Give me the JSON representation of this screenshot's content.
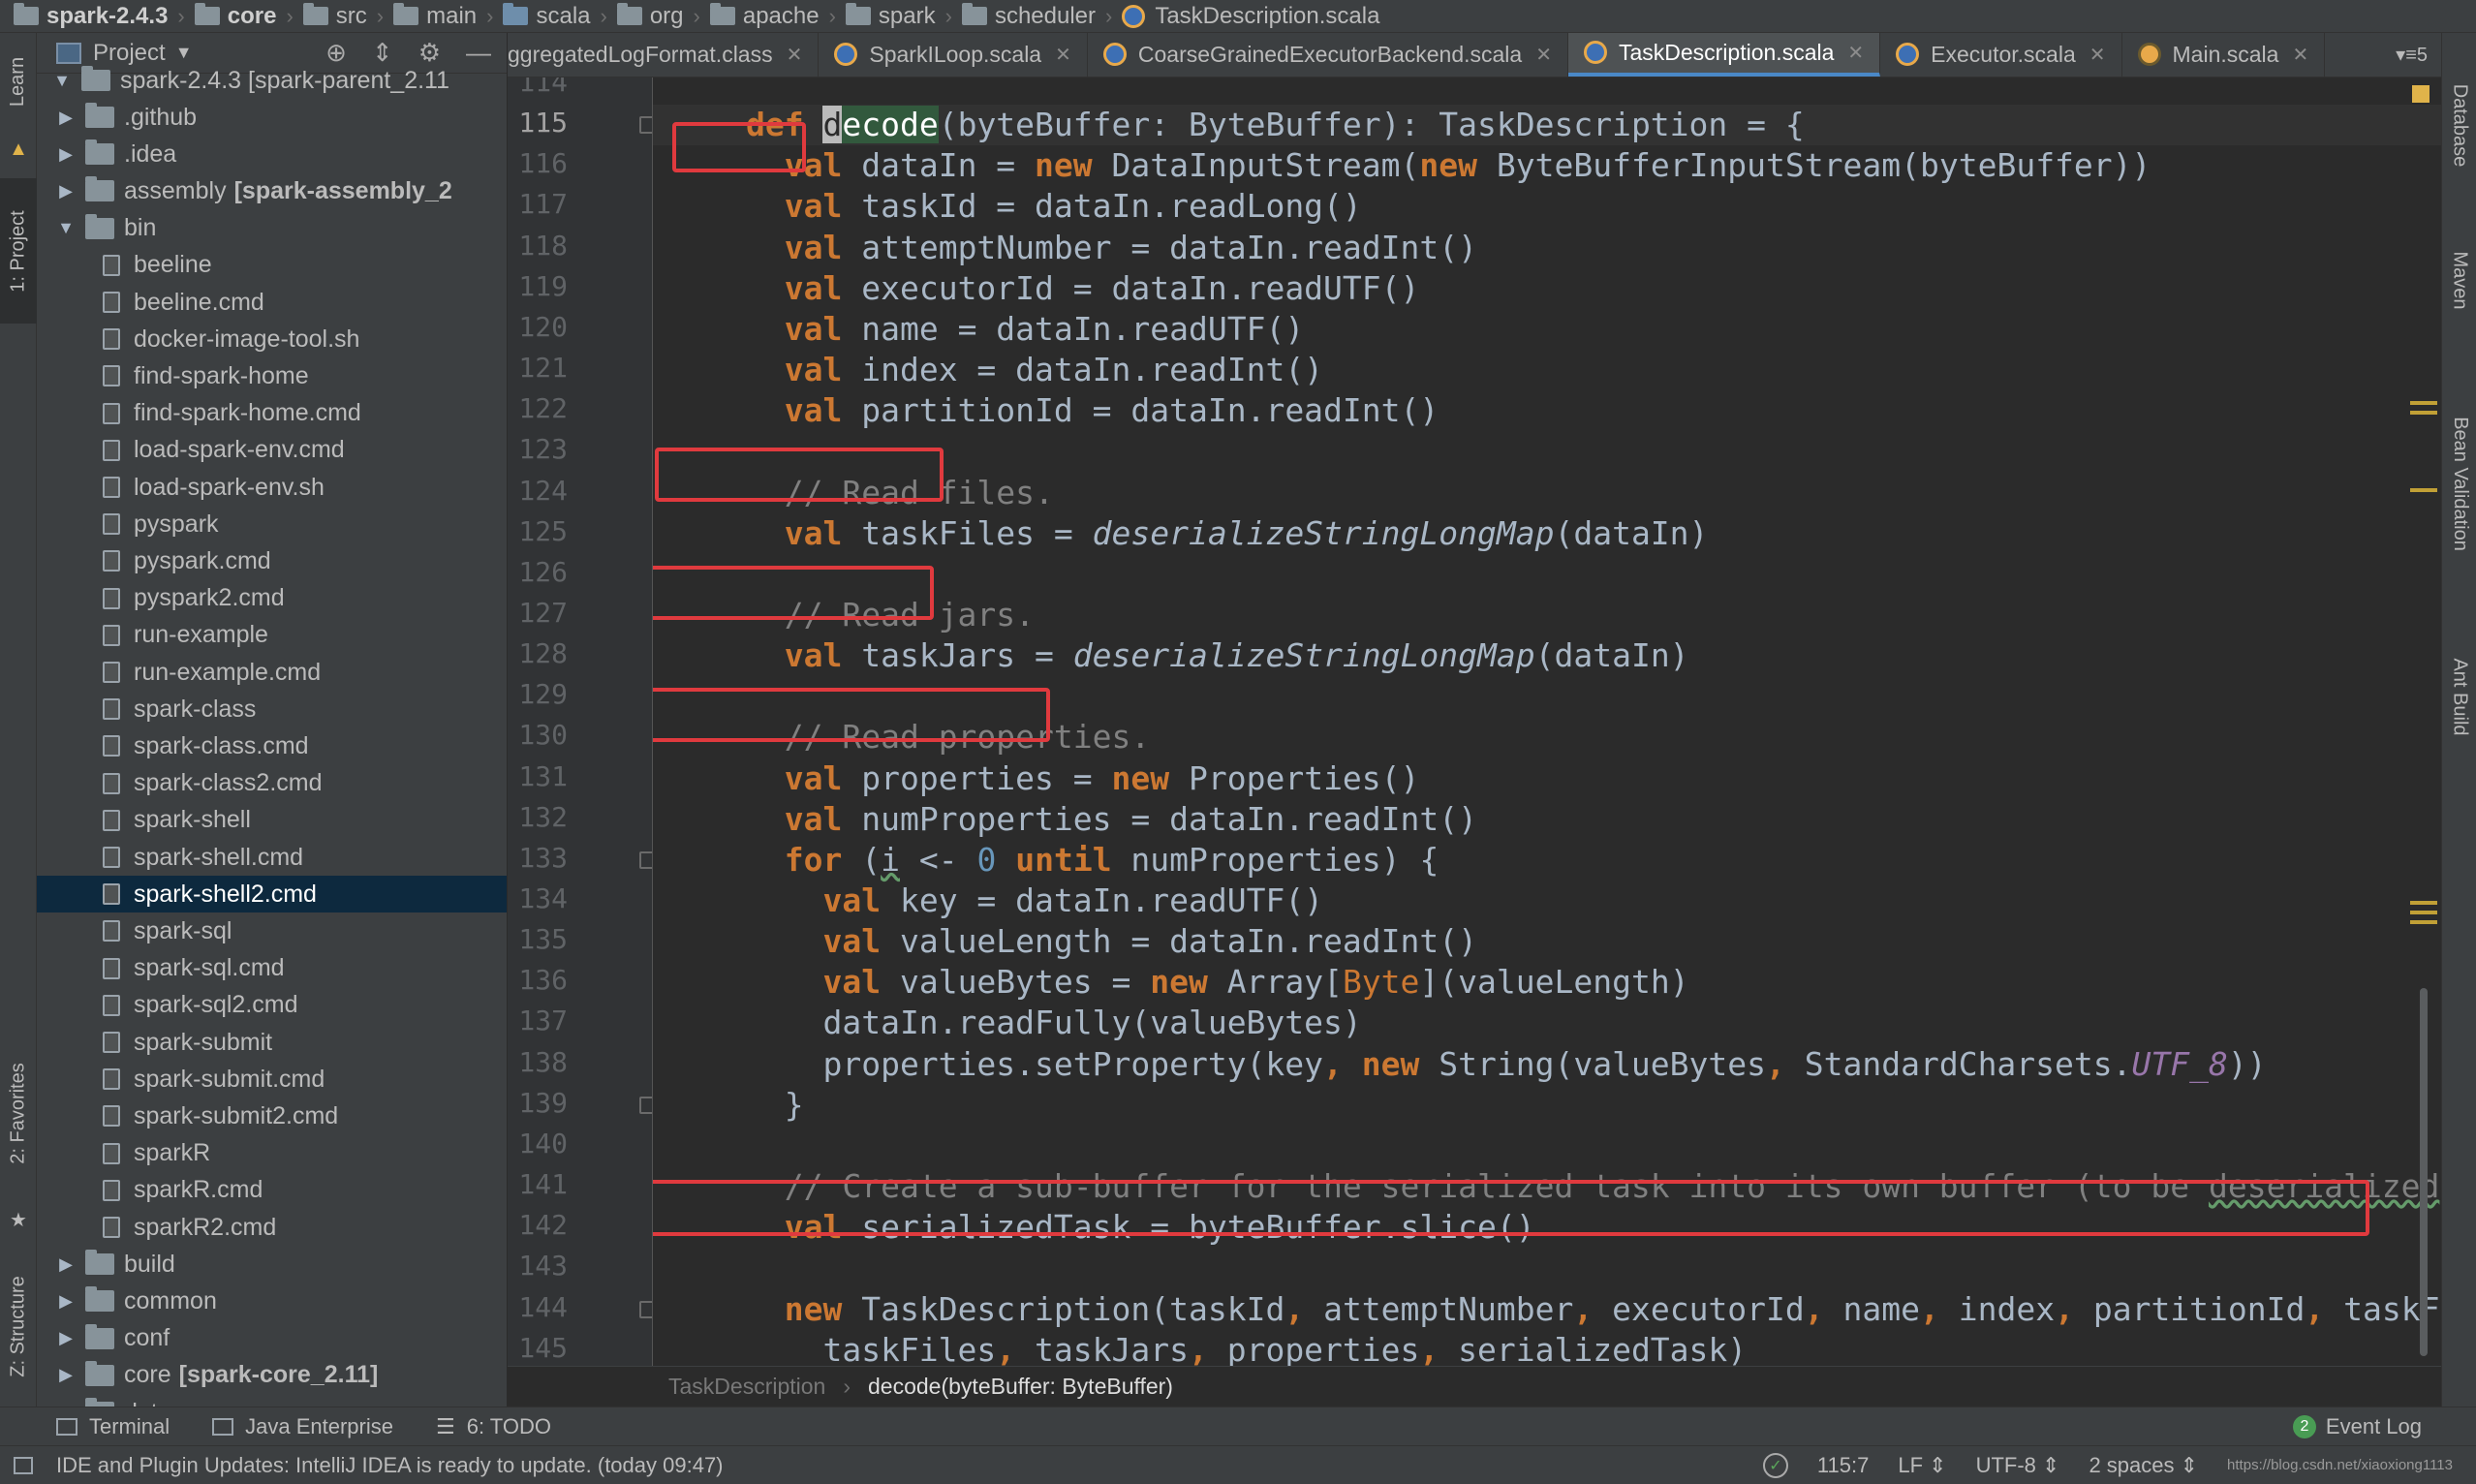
{
  "breadcrumb": [
    {
      "label": "spark-2.4.3",
      "bold": true
    },
    {
      "label": "core",
      "bold": true
    },
    {
      "label": "src"
    },
    {
      "label": "main"
    },
    {
      "label": "scala"
    },
    {
      "label": "org"
    },
    {
      "label": "apache"
    },
    {
      "label": "spark"
    },
    {
      "label": "scheduler"
    },
    {
      "label": "TaskDescription.scala",
      "file": true
    }
  ],
  "left_strip": {
    "learn": "Learn",
    "project": "1: Project",
    "favorites": "2: Favorites",
    "structure": "Z: Structure"
  },
  "right_strip": {
    "database": "Database",
    "maven": "Maven",
    "bean": "Bean Validation",
    "ant": "Ant Build"
  },
  "project_panel": {
    "title": "Project",
    "root_label": "spark-2.4.3 [spark-parent_2.11",
    "items": [
      {
        "label": ".github",
        "type": "folder",
        "depth": 1,
        "expanded": false
      },
      {
        "label": ".idea",
        "type": "folder",
        "depth": 1,
        "expanded": false
      },
      {
        "label": "assembly",
        "module": "[spark-assembly_2",
        "type": "folder",
        "depth": 1,
        "expanded": false
      },
      {
        "label": "bin",
        "type": "folder",
        "depth": 1,
        "expanded": true
      },
      {
        "label": "beeline",
        "type": "file",
        "depth": 2
      },
      {
        "label": "beeline.cmd",
        "type": "file",
        "depth": 2
      },
      {
        "label": "docker-image-tool.sh",
        "type": "file",
        "depth": 2
      },
      {
        "label": "find-spark-home",
        "type": "file",
        "depth": 2
      },
      {
        "label": "find-spark-home.cmd",
        "type": "file",
        "depth": 2
      },
      {
        "label": "load-spark-env.cmd",
        "type": "file",
        "depth": 2
      },
      {
        "label": "load-spark-env.sh",
        "type": "file",
        "depth": 2
      },
      {
        "label": "pyspark",
        "type": "file",
        "depth": 2
      },
      {
        "label": "pyspark.cmd",
        "type": "file",
        "depth": 2
      },
      {
        "label": "pyspark2.cmd",
        "type": "file",
        "depth": 2
      },
      {
        "label": "run-example",
        "type": "file",
        "depth": 2
      },
      {
        "label": "run-example.cmd",
        "type": "file",
        "depth": 2
      },
      {
        "label": "spark-class",
        "type": "file",
        "depth": 2
      },
      {
        "label": "spark-class.cmd",
        "type": "file",
        "depth": 2
      },
      {
        "label": "spark-class2.cmd",
        "type": "file",
        "depth": 2
      },
      {
        "label": "spark-shell",
        "type": "file",
        "depth": 2
      },
      {
        "label": "spark-shell.cmd",
        "type": "file",
        "depth": 2
      },
      {
        "label": "spark-shell2.cmd",
        "type": "file",
        "depth": 2,
        "selected": true
      },
      {
        "label": "spark-sql",
        "type": "file",
        "depth": 2
      },
      {
        "label": "spark-sql.cmd",
        "type": "file",
        "depth": 2
      },
      {
        "label": "spark-sql2.cmd",
        "type": "file",
        "depth": 2
      },
      {
        "label": "spark-submit",
        "type": "file",
        "depth": 2
      },
      {
        "label": "spark-submit.cmd",
        "type": "file",
        "depth": 2
      },
      {
        "label": "spark-submit2.cmd",
        "type": "file",
        "depth": 2
      },
      {
        "label": "sparkR",
        "type": "file",
        "depth": 2
      },
      {
        "label": "sparkR.cmd",
        "type": "file",
        "depth": 2
      },
      {
        "label": "sparkR2.cmd",
        "type": "file",
        "depth": 2
      },
      {
        "label": "build",
        "type": "folder",
        "depth": 1,
        "expanded": false
      },
      {
        "label": "common",
        "type": "folder",
        "depth": 1,
        "expanded": false
      },
      {
        "label": "conf",
        "type": "folder",
        "depth": 1,
        "expanded": false
      },
      {
        "label": "core",
        "module": "[spark-core_2.11]",
        "type": "folder",
        "depth": 1,
        "expanded": false
      },
      {
        "label": "data",
        "type": "folder",
        "depth": 1,
        "expanded": false
      }
    ]
  },
  "tabs": [
    {
      "label": "ggregatedLogFormat.class",
      "icon": "class"
    },
    {
      "label": "SparkILoop.scala",
      "icon": "scala"
    },
    {
      "label": "CoarseGrainedExecutorBackend.scala",
      "icon": "scala"
    },
    {
      "label": "TaskDescription.scala",
      "icon": "scala",
      "active": true
    },
    {
      "label": "Executor.scala",
      "icon": "scala"
    },
    {
      "label": "Main.scala",
      "icon": "object"
    }
  ],
  "tab_overflow": "5",
  "editor": {
    "first_line": 114,
    "current_line": 115,
    "lines": [
      "",
      "def decode(byteBuffer: ByteBuffer): TaskDescription = {",
      "  val dataIn = new DataInputStream(new ByteBufferInputStream(byteBuffer))",
      "  val taskId = dataIn.readLong()",
      "  val attemptNumber = dataIn.readInt()",
      "  val executorId = dataIn.readUTF()",
      "  val name = dataIn.readUTF()",
      "  val index = dataIn.readInt()",
      "  val partitionId = dataIn.readInt()",
      "",
      "  // Read files.",
      "  val taskFiles = deserializeStringLongMap(dataIn)",
      "",
      "  // Read jars.",
      "  val taskJars = deserializeStringLongMap(dataIn)",
      "",
      "  // Read properties.",
      "  val properties = new Properties()",
      "  val numProperties = dataIn.readInt()",
      "  for (i <- 0 until numProperties) {",
      "    val key = dataIn.readUTF()",
      "    val valueLength = dataIn.readInt()",
      "    val valueBytes = new Array[Byte](valueLength)",
      "    dataIn.readFully(valueBytes)",
      "    properties.setProperty(key, new String(valueBytes, StandardCharsets.UTF_8))",
      "  }",
      "",
      "  // Create a sub-buffer for the serialized task into its own buffer (to be deserialized",
      "  val serializedTask = byteBuffer.slice()",
      "",
      "  new TaskDescription(taskId, attemptNumber, executorId, name, index, partitionId, taskFil",
      "    taskFiles, taskJars, properties, serializedTask)"
    ]
  },
  "code_breadcrumb": {
    "class": "TaskDescription",
    "method": "decode(byteBuffer: ByteBuffer)"
  },
  "bottom_tools": {
    "terminal": "Terminal",
    "java_ee": "Java Enterprise",
    "todo": "6: TODO",
    "event_log": "Event Log",
    "event_count": "2"
  },
  "status": {
    "message": "IDE and Plugin Updates: IntelliJ IDEA is ready to update. (today 09:47)",
    "position": "115:7",
    "line_sep": "LF",
    "encoding": "UTF-8",
    "indent": "2 spaces",
    "watermark": "https://blog.csdn.net/xiaoxiong1113"
  },
  "colors": {
    "keyword": "#cc7832",
    "comment": "#808080",
    "annotation_box": "#e03a3e",
    "selection": "#0d293e",
    "tab_active_underline": "#4a88c7"
  }
}
